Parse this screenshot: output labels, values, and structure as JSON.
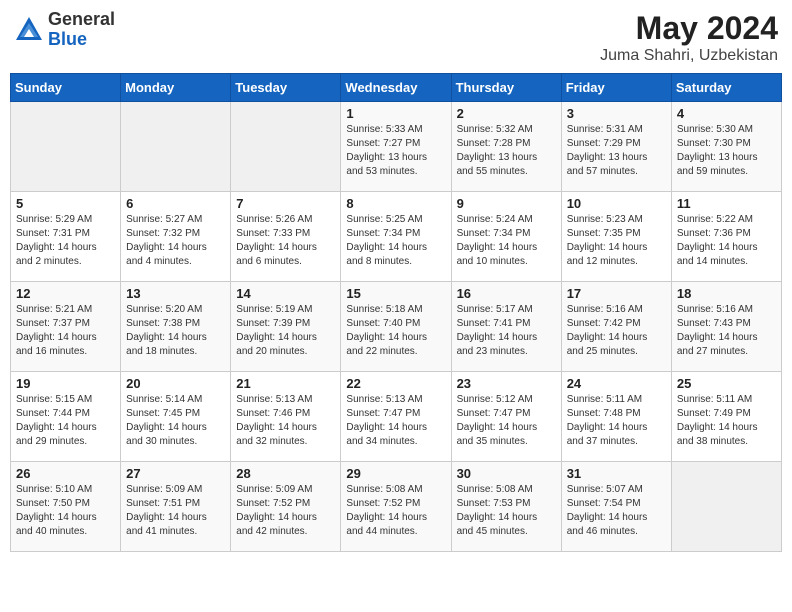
{
  "header": {
    "logo_general": "General",
    "logo_blue": "Blue",
    "title": "May 2024",
    "subtitle": "Juma Shahri, Uzbekistan"
  },
  "weekdays": [
    "Sunday",
    "Monday",
    "Tuesday",
    "Wednesday",
    "Thursday",
    "Friday",
    "Saturday"
  ],
  "weeks": [
    [
      {
        "day": "",
        "info": ""
      },
      {
        "day": "",
        "info": ""
      },
      {
        "day": "",
        "info": ""
      },
      {
        "day": "1",
        "info": "Sunrise: 5:33 AM\nSunset: 7:27 PM\nDaylight: 13 hours\nand 53 minutes."
      },
      {
        "day": "2",
        "info": "Sunrise: 5:32 AM\nSunset: 7:28 PM\nDaylight: 13 hours\nand 55 minutes."
      },
      {
        "day": "3",
        "info": "Sunrise: 5:31 AM\nSunset: 7:29 PM\nDaylight: 13 hours\nand 57 minutes."
      },
      {
        "day": "4",
        "info": "Sunrise: 5:30 AM\nSunset: 7:30 PM\nDaylight: 13 hours\nand 59 minutes."
      }
    ],
    [
      {
        "day": "5",
        "info": "Sunrise: 5:29 AM\nSunset: 7:31 PM\nDaylight: 14 hours\nand 2 minutes."
      },
      {
        "day": "6",
        "info": "Sunrise: 5:27 AM\nSunset: 7:32 PM\nDaylight: 14 hours\nand 4 minutes."
      },
      {
        "day": "7",
        "info": "Sunrise: 5:26 AM\nSunset: 7:33 PM\nDaylight: 14 hours\nand 6 minutes."
      },
      {
        "day": "8",
        "info": "Sunrise: 5:25 AM\nSunset: 7:34 PM\nDaylight: 14 hours\nand 8 minutes."
      },
      {
        "day": "9",
        "info": "Sunrise: 5:24 AM\nSunset: 7:34 PM\nDaylight: 14 hours\nand 10 minutes."
      },
      {
        "day": "10",
        "info": "Sunrise: 5:23 AM\nSunset: 7:35 PM\nDaylight: 14 hours\nand 12 minutes."
      },
      {
        "day": "11",
        "info": "Sunrise: 5:22 AM\nSunset: 7:36 PM\nDaylight: 14 hours\nand 14 minutes."
      }
    ],
    [
      {
        "day": "12",
        "info": "Sunrise: 5:21 AM\nSunset: 7:37 PM\nDaylight: 14 hours\nand 16 minutes."
      },
      {
        "day": "13",
        "info": "Sunrise: 5:20 AM\nSunset: 7:38 PM\nDaylight: 14 hours\nand 18 minutes."
      },
      {
        "day": "14",
        "info": "Sunrise: 5:19 AM\nSunset: 7:39 PM\nDaylight: 14 hours\nand 20 minutes."
      },
      {
        "day": "15",
        "info": "Sunrise: 5:18 AM\nSunset: 7:40 PM\nDaylight: 14 hours\nand 22 minutes."
      },
      {
        "day": "16",
        "info": "Sunrise: 5:17 AM\nSunset: 7:41 PM\nDaylight: 14 hours\nand 23 minutes."
      },
      {
        "day": "17",
        "info": "Sunrise: 5:16 AM\nSunset: 7:42 PM\nDaylight: 14 hours\nand 25 minutes."
      },
      {
        "day": "18",
        "info": "Sunrise: 5:16 AM\nSunset: 7:43 PM\nDaylight: 14 hours\nand 27 minutes."
      }
    ],
    [
      {
        "day": "19",
        "info": "Sunrise: 5:15 AM\nSunset: 7:44 PM\nDaylight: 14 hours\nand 29 minutes."
      },
      {
        "day": "20",
        "info": "Sunrise: 5:14 AM\nSunset: 7:45 PM\nDaylight: 14 hours\nand 30 minutes."
      },
      {
        "day": "21",
        "info": "Sunrise: 5:13 AM\nSunset: 7:46 PM\nDaylight: 14 hours\nand 32 minutes."
      },
      {
        "day": "22",
        "info": "Sunrise: 5:13 AM\nSunset: 7:47 PM\nDaylight: 14 hours\nand 34 minutes."
      },
      {
        "day": "23",
        "info": "Sunrise: 5:12 AM\nSunset: 7:47 PM\nDaylight: 14 hours\nand 35 minutes."
      },
      {
        "day": "24",
        "info": "Sunrise: 5:11 AM\nSunset: 7:48 PM\nDaylight: 14 hours\nand 37 minutes."
      },
      {
        "day": "25",
        "info": "Sunrise: 5:11 AM\nSunset: 7:49 PM\nDaylight: 14 hours\nand 38 minutes."
      }
    ],
    [
      {
        "day": "26",
        "info": "Sunrise: 5:10 AM\nSunset: 7:50 PM\nDaylight: 14 hours\nand 40 minutes."
      },
      {
        "day": "27",
        "info": "Sunrise: 5:09 AM\nSunset: 7:51 PM\nDaylight: 14 hours\nand 41 minutes."
      },
      {
        "day": "28",
        "info": "Sunrise: 5:09 AM\nSunset: 7:52 PM\nDaylight: 14 hours\nand 42 minutes."
      },
      {
        "day": "29",
        "info": "Sunrise: 5:08 AM\nSunset: 7:52 PM\nDaylight: 14 hours\nand 44 minutes."
      },
      {
        "day": "30",
        "info": "Sunrise: 5:08 AM\nSunset: 7:53 PM\nDaylight: 14 hours\nand 45 minutes."
      },
      {
        "day": "31",
        "info": "Sunrise: 5:07 AM\nSunset: 7:54 PM\nDaylight: 14 hours\nand 46 minutes."
      },
      {
        "day": "",
        "info": ""
      }
    ]
  ]
}
